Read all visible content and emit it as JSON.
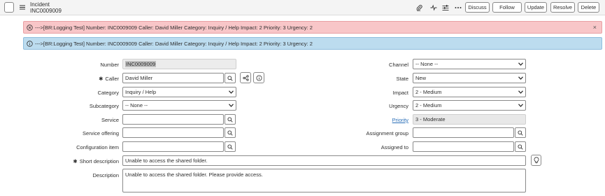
{
  "header": {
    "record_type": "Incident",
    "record_number": "INC0009009",
    "buttons": {
      "discuss": "Discuss",
      "follow": "Follow",
      "update": "Update",
      "resolve": "Resolve",
      "delete": "Delete"
    }
  },
  "banners": {
    "error": "--->[BR:Logging Test] Number: INC0009009 Caller: David Miller Category: Inquiry / Help Impact: 2 Priority: 3 Urgency: 2",
    "info": "--->[BR:Logging Test] Number: INC0009009 Caller: David Miller Category: Inquiry / Help Impact: 2 Priority: 3 Urgency: 2",
    "close_glyph": "×"
  },
  "form": {
    "number": {
      "label": "Number",
      "value": "INC0009009"
    },
    "caller": {
      "label": "Caller",
      "value": "David Miller",
      "required_mark": "✱"
    },
    "category": {
      "label": "Category",
      "value": "Inquiry / Help"
    },
    "subcategory": {
      "label": "Subcategory",
      "value": "-- None --"
    },
    "service": {
      "label": "Service",
      "value": ""
    },
    "service_offering": {
      "label": "Service offering",
      "value": ""
    },
    "configuration_item": {
      "label": "Configuration item",
      "value": ""
    },
    "short_description": {
      "label": "Short description",
      "value": "Unable to access the shared folder.",
      "required_mark": "✱"
    },
    "description": {
      "label": "Description",
      "value": "Unable to access the shared folder. Please provide access."
    },
    "channel": {
      "label": "Channel",
      "value": "-- None --"
    },
    "state": {
      "label": "State",
      "value": "New"
    },
    "impact": {
      "label": "Impact",
      "value": "2 - Medium"
    },
    "urgency": {
      "label": "Urgency",
      "value": "2 - Medium"
    },
    "priority": {
      "label": "Priority",
      "value": "3 - Moderate"
    },
    "assignment_group": {
      "label": "Assignment group",
      "value": ""
    },
    "assigned_to": {
      "label": "Assigned to",
      "value": ""
    }
  },
  "icons": {
    "back": "chevron-left-icon",
    "menu": "hamburger-menu-icon",
    "attachment": "paperclip-icon",
    "activity": "activity-pulse-icon",
    "settings": "sliders-icon",
    "more": "more-options-icon",
    "search": "search-icon",
    "tree": "dependency-tree-icon",
    "info": "info-icon",
    "lightbulb": "lightbulb-icon"
  },
  "colors": {
    "error_bg": "#f8c6c8",
    "info_bg": "#bcdcef",
    "link": "#2a6fb8"
  }
}
